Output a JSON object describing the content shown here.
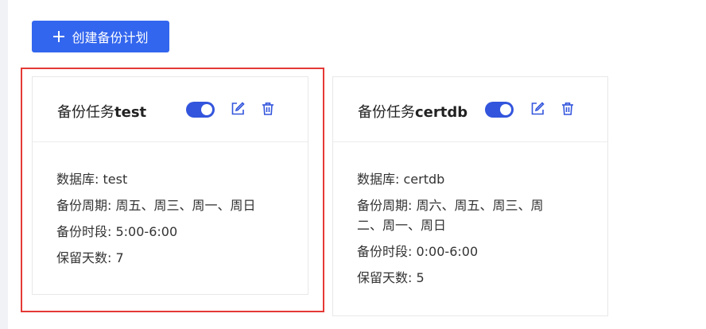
{
  "toolbar": {
    "create_label": "创建备份计划",
    "create_icon": "plus-icon",
    "accent_color": "#3366ee"
  },
  "cards": [
    {
      "title_prefix": "备份任务",
      "title_name": "test",
      "enabled": true,
      "database_label": "数据库: ",
      "database": "test",
      "period_label": "备份周期: ",
      "period": "周五、周三、周一、周日",
      "window_label": "备份时段: ",
      "window": "5:00-6:00",
      "retention_label": "保留天数: ",
      "retention": "7",
      "icons": [
        "toggle-switch",
        "edit-icon",
        "trash-icon"
      ]
    },
    {
      "title_prefix": "备份任务",
      "title_name": "certdb",
      "enabled": true,
      "database_label": "数据库: ",
      "database": "certdb",
      "period_label": "备份周期: ",
      "period_line1": "周六、周五、周三、周",
      "period_line2": "二、周一、周日",
      "window_label": "备份时段: ",
      "window": "0:00-6:00",
      "retention_label": "保留天数: ",
      "retention": "5",
      "icons": [
        "toggle-switch",
        "edit-icon",
        "trash-icon"
      ]
    }
  ],
  "highlight_color": "#e53935"
}
